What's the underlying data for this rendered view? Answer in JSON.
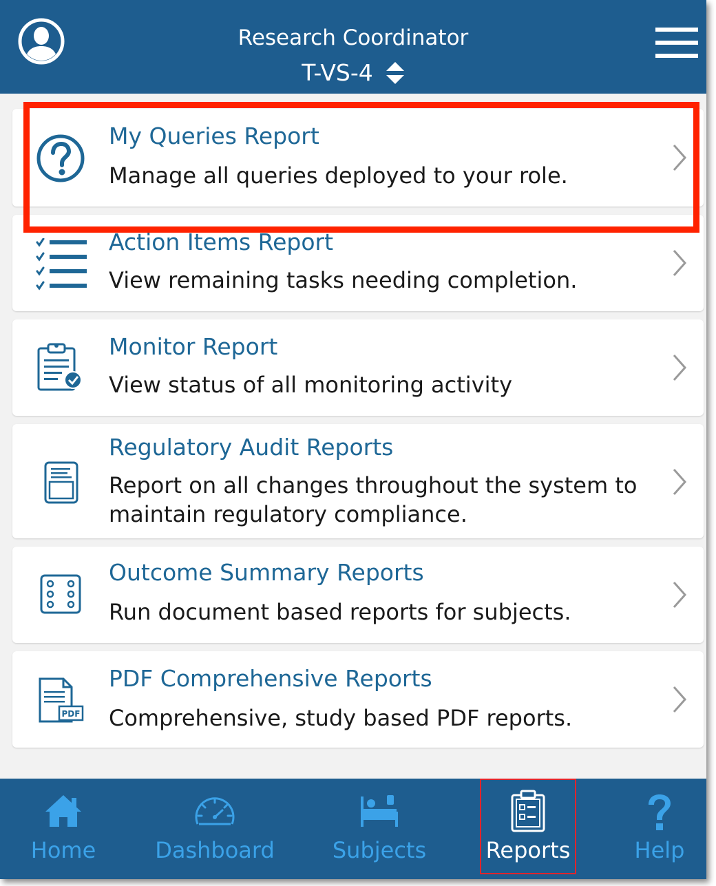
{
  "header": {
    "title": "Research Coordinator",
    "study": "T-VS-4",
    "avatar_icon": "user-avatar-icon",
    "menu_icon": "hamburger-menu-icon"
  },
  "reports": [
    {
      "title": "My Queries Report",
      "description": "Manage all queries deployed to your role.",
      "icon": "question-circle-icon"
    },
    {
      "title": "Action Items Report",
      "description": "View remaining tasks needing completion.",
      "icon": "checklist-icon"
    },
    {
      "title": "Monitor Report",
      "description": "View status of all monitoring activity",
      "icon": "clipboard-check-icon"
    },
    {
      "title": "Regulatory Audit Reports",
      "description": "Report on all changes throughout the system to maintain regulatory compliance.",
      "icon": "document-icon"
    },
    {
      "title": "Outcome Summary Reports",
      "description": "Run document based reports for subjects.",
      "icon": "dice-six-icon"
    },
    {
      "title": "PDF Comprehensive Reports",
      "description": "Comprehensive, study based PDF reports.",
      "icon": "pdf-file-icon"
    }
  ],
  "bottom_nav": [
    {
      "label": "Home",
      "icon": "home-icon",
      "active": false
    },
    {
      "label": "Dashboard",
      "icon": "speedometer-icon",
      "active": false
    },
    {
      "label": "Subjects",
      "icon": "bed-icon",
      "active": false
    },
    {
      "label": "Reports",
      "icon": "clipboard-list-icon",
      "active": true
    },
    {
      "label": "Help",
      "icon": "question-mark-icon",
      "active": false
    }
  ],
  "colors": {
    "header_bg": "#1e5d8f",
    "accent_blue": "#1e6796",
    "nav_inactive": "#3ba2e8",
    "highlight_red": "#ff2200"
  }
}
